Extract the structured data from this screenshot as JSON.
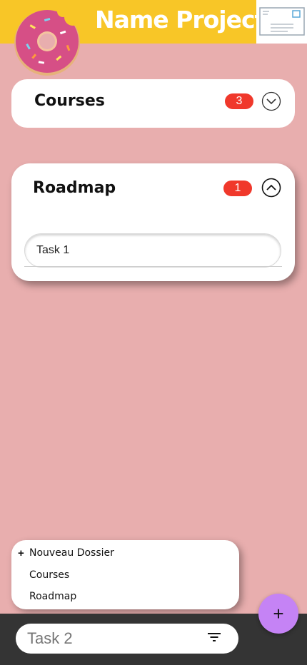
{
  "header": {
    "title": "Name Project",
    "logo_icon": "donut-icon",
    "mail_icon": "envelope-icon"
  },
  "folders": [
    {
      "name": "Courses",
      "count": "3",
      "expanded": false,
      "toggle_icon": "chevron-down-icon"
    },
    {
      "name": "Roadmap",
      "count": "1",
      "expanded": true,
      "toggle_icon": "chevron-up-icon",
      "tasks": [
        {
          "value": "Task 1"
        }
      ]
    }
  ],
  "folder_menu": {
    "new_folder_symbol": "+",
    "new_folder_label": "Nouveau Dossier",
    "items": [
      "Courses",
      "Roadmap"
    ]
  },
  "bottom_bar": {
    "task_input_placeholder": "Task 2",
    "filter_icon": "filter-icon",
    "add_button_label": "+"
  },
  "colors": {
    "background": "#e8aeae",
    "header": "#f8c627",
    "badge": "#f0382b",
    "fab": "#c583f5",
    "bottom_bar": "#343434"
  }
}
